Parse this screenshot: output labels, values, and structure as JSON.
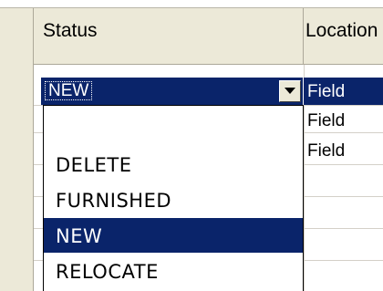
{
  "columns": {
    "status_header": "Status",
    "location_header": "Location"
  },
  "editing_row": {
    "status_value": "NEW",
    "location": "Field"
  },
  "rows": [
    {
      "location": "Field"
    },
    {
      "location": "Field"
    }
  ],
  "status_dropdown": {
    "options": [
      "",
      "DELETE",
      "FURNISHED",
      "NEW",
      "RELOCATE"
    ],
    "selected": "NEW"
  },
  "colors": {
    "selection": "#0a246a",
    "header_bg": "#ece9d8"
  },
  "icons": {
    "dropdown_button": "chevron-down-icon"
  }
}
